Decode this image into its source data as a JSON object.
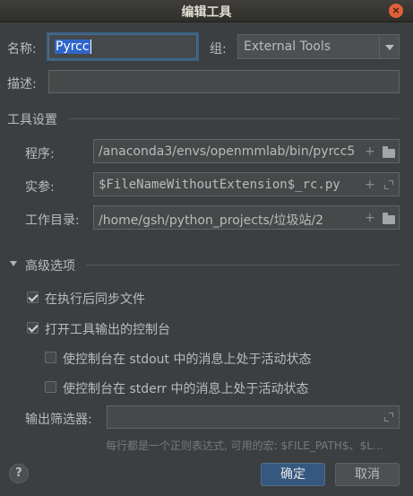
{
  "window": {
    "title": "编辑工具",
    "close_glyph": "×"
  },
  "form": {
    "name_label": "名称:",
    "name_value": "Pyrcc",
    "group_label": "组:",
    "group_value": "External Tools",
    "description_label": "描述:",
    "description_value": ""
  },
  "tool_settings": {
    "section_title": "工具设置",
    "program_label": "程序:",
    "program_value": "/anaconda3/envs/openmmlab/bin/pyrcc5",
    "arguments_label": "实参:",
    "arguments_value": "$FileNameWithoutExtension$_rc.py",
    "workdir_label": "工作目录:",
    "workdir_value": "/home/gsh/python_projects/垃圾站/2",
    "plus_glyph": "+"
  },
  "advanced": {
    "section_title": "高级选项",
    "sync_files": {
      "label": "在执行后同步文件",
      "checked": true
    },
    "open_console": {
      "label": "打开工具输出的控制台",
      "checked": true
    },
    "stdout_active": {
      "label": "使控制台在 stdout 中的消息上处于活动状态",
      "checked": false
    },
    "stderr_active": {
      "label": "使控制台在 stderr 中的消息上处于活动状态",
      "checked": false
    },
    "output_filter_label": "输出筛选器:",
    "output_filter_value": "",
    "hint": "每行都是一个正则表达式, 可用的宏: $FILE_PATH$、$L..."
  },
  "footer": {
    "help_glyph": "?",
    "ok_label": "确定",
    "cancel_label": "取消"
  },
  "colors": {
    "accent": "#365880",
    "selection": "#2f65ca",
    "background": "#3c3f41"
  }
}
